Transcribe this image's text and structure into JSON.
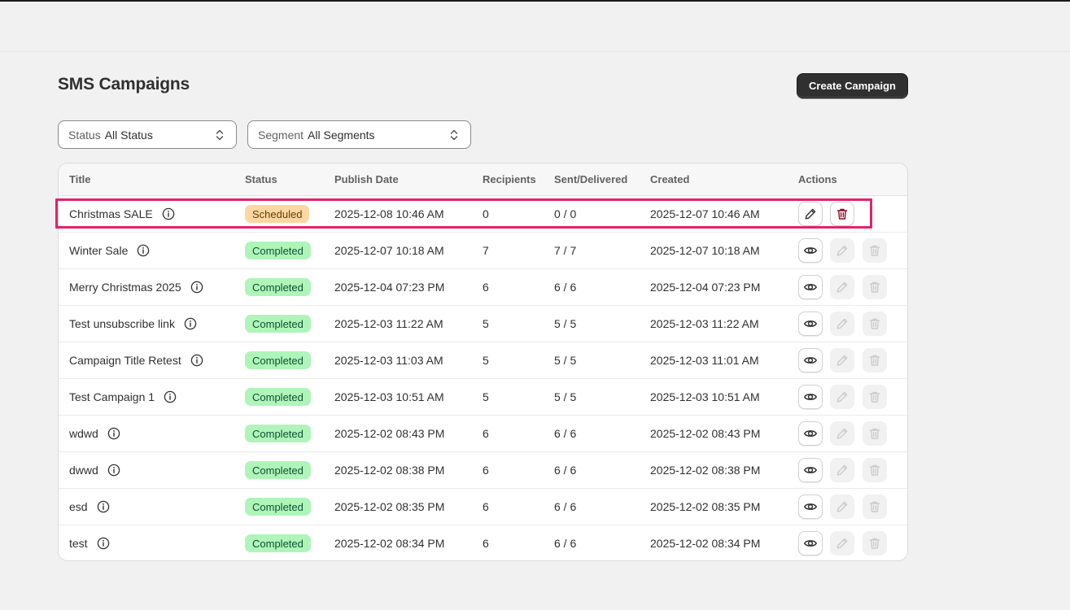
{
  "page": {
    "title": "SMS Campaigns",
    "create_label": "Create Campaign"
  },
  "filters": {
    "status": {
      "label": "Status",
      "value": "All Status"
    },
    "segment": {
      "label": "Segment",
      "value": "All Segments"
    }
  },
  "table": {
    "headers": [
      "Title",
      "Status",
      "Publish Date",
      "Recipients",
      "Sent/Delivered",
      "Created",
      "Actions"
    ],
    "rows": [
      {
        "title": "Christmas SALE",
        "status": "Scheduled",
        "publish": "2025-12-08 10:46 AM",
        "recipients": "0",
        "sent": "0 / 0",
        "created": "2025-12-07 10:46 AM",
        "actions": [
          "edit",
          "delete"
        ]
      },
      {
        "title": "Winter Sale",
        "status": "Completed",
        "publish": "2025-12-07 10:18 AM",
        "recipients": "7",
        "sent": "7 / 7",
        "created": "2025-12-07 10:18 AM",
        "actions": [
          "view"
        ]
      },
      {
        "title": "Merry Christmas 2025",
        "status": "Completed",
        "publish": "2025-12-04 07:23 PM",
        "recipients": "6",
        "sent": "6 / 6",
        "created": "2025-12-04 07:23 PM",
        "actions": [
          "view"
        ]
      },
      {
        "title": "Test unsubscribe link",
        "status": "Completed",
        "publish": "2025-12-03 11:22 AM",
        "recipients": "5",
        "sent": "5 / 5",
        "created": "2025-12-03 11:22 AM",
        "actions": [
          "view"
        ]
      },
      {
        "title": "Campaign Title Retest",
        "status": "Completed",
        "publish": "2025-12-03 11:03 AM",
        "recipients": "5",
        "sent": "5 / 5",
        "created": "2025-12-03 11:01 AM",
        "actions": [
          "view"
        ]
      },
      {
        "title": "Test Campaign 1",
        "status": "Completed",
        "publish": "2025-12-03 10:51 AM",
        "recipients": "5",
        "sent": "5 / 5",
        "created": "2025-12-03 10:51 AM",
        "actions": [
          "view"
        ]
      },
      {
        "title": "wdwd",
        "status": "Completed",
        "publish": "2025-12-02 08:43 PM",
        "recipients": "6",
        "sent": "6 / 6",
        "created": "2025-12-02 08:43 PM",
        "actions": [
          "view"
        ]
      },
      {
        "title": "dwwd",
        "status": "Completed",
        "publish": "2025-12-02 08:38 PM",
        "recipients": "6",
        "sent": "6 / 6",
        "created": "2025-12-02 08:38 PM",
        "actions": [
          "view"
        ]
      },
      {
        "title": "esd",
        "status": "Completed",
        "publish": "2025-12-02 08:35 PM",
        "recipients": "6",
        "sent": "6 / 6",
        "created": "2025-12-02 08:35 PM",
        "actions": [
          "view"
        ]
      },
      {
        "title": "test",
        "status": "Completed",
        "publish": "2025-12-02 08:34 PM",
        "recipients": "6",
        "sent": "6 / 6",
        "created": "2025-12-02 08:34 PM",
        "actions": [
          "view"
        ]
      }
    ]
  },
  "colors": {
    "highlight": "#e3226b",
    "completed_bg": "#aff5b9",
    "scheduled_bg": "#ffd6a4",
    "delete_red": "#8e0b21",
    "primary_button": "#303030"
  },
  "icons": {
    "info": "info-icon",
    "view": "eye-icon",
    "edit": "pencil-icon",
    "delete": "trash-icon",
    "select": "chevron-up-down-icon"
  }
}
